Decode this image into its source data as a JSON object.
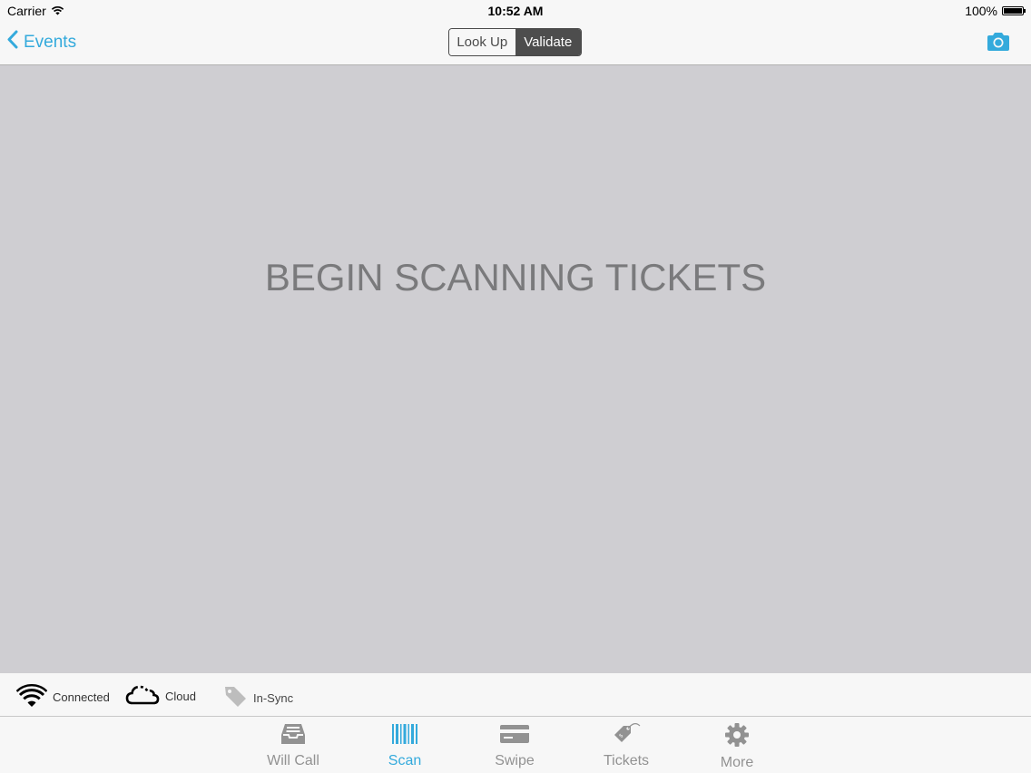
{
  "status_bar": {
    "carrier": "Carrier",
    "time": "10:52 AM",
    "battery": "100%"
  },
  "nav": {
    "back_label": "Events",
    "segments": [
      {
        "label": "Look Up",
        "active": false
      },
      {
        "label": "Validate",
        "active": true
      }
    ],
    "camera_icon": "camera-icon"
  },
  "main": {
    "prompt": "BEGIN SCANNING TICKETS"
  },
  "status_strip": {
    "connection": "Connected",
    "mode": "Cloud",
    "sync": "In-Sync"
  },
  "tabs": [
    {
      "label": "Will Call",
      "icon": "inbox-icon",
      "active": false
    },
    {
      "label": "Scan",
      "icon": "barcode-icon",
      "active": true
    },
    {
      "label": "Swipe",
      "icon": "credit-card-icon",
      "active": false
    },
    {
      "label": "Tickets",
      "icon": "tag-icon",
      "active": false
    },
    {
      "label": "More",
      "icon": "gear-icon",
      "active": false
    }
  ],
  "colors": {
    "accent": "#34aadc",
    "main_background": "#cfced2",
    "bar_background": "#f7f7f7",
    "segment_active": "#4d4d4d"
  }
}
